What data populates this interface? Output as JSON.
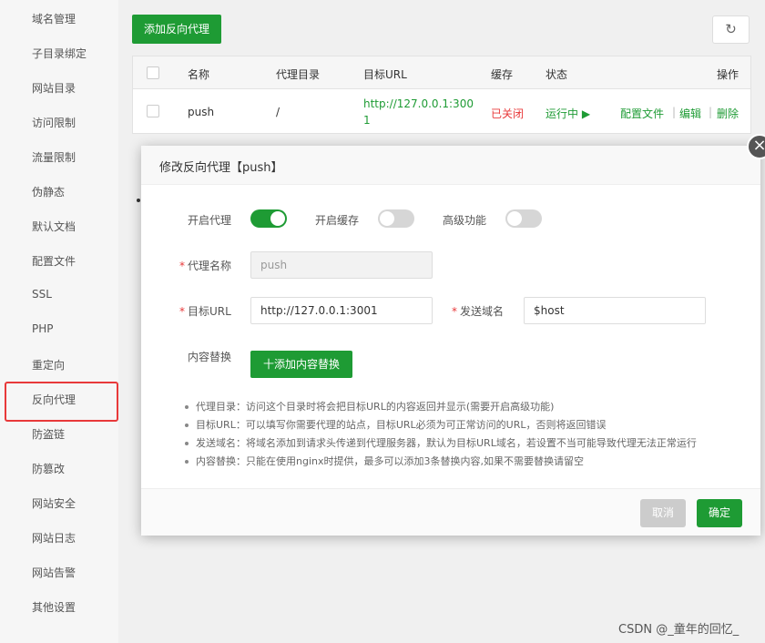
{
  "sidebar": {
    "items": [
      "域名管理",
      "子目录绑定",
      "网站目录",
      "访问限制",
      "流量限制",
      "伪静态",
      "默认文档",
      "配置文件",
      "SSL",
      "PHP",
      "重定向",
      "反向代理",
      "防盗链",
      "防篡改",
      "网站安全",
      "网站日志",
      "网站告警",
      "其他设置"
    ],
    "active": "反向代理"
  },
  "toolbar": {
    "add_proxy_label": "添加反向代理",
    "refresh_icon": "↻"
  },
  "table": {
    "headers": {
      "name": "名称",
      "dir": "代理目录",
      "url": "目标URL",
      "cache": "缓存",
      "status": "状态",
      "ops": "操作"
    },
    "row": {
      "name": "push",
      "dir": "/",
      "url_line1": "http://127.0.0.1:300",
      "url_line2": "1",
      "cache": "已关闭",
      "status": "运行中 ▶",
      "op_config": "配置文件",
      "op_edit": "编辑",
      "op_delete": "删除",
      "sep": "|"
    }
  },
  "modal": {
    "title": "修改反向代理【push】",
    "close": "×",
    "toggles": {
      "proxy_label": "开启代理",
      "proxy_on": true,
      "cache_label": "开启缓存",
      "cache_on": false,
      "advanced_label": "高级功能",
      "advanced_on": false
    },
    "required_mark": "*",
    "name_label": "代理名称",
    "name_value": "push",
    "target_label": "目标URL",
    "target_value": "http://127.0.0.1:3001",
    "host_label": "发送域名",
    "host_value": "$host",
    "replace_label": "内容替换",
    "add_replace_label": "十添加内容替换",
    "help": [
      "代理目录：访问这个目录时将会把目标URL的内容返回并显示(需要开启高级功能)",
      "目标URL：可以填写你需要代理的站点，目标URL必须为可正常访问的URL，否则将返回错误",
      "发送域名：将域名添加到请求头传递到代理服务器，默认为目标URL域名，若设置不当可能导致代理无法正常运行",
      "内容替换：只能在使用nginx时提供，最多可以添加3条替换内容,如果不需要替换请留空"
    ],
    "cancel_label": "取消",
    "ok_label": "确定"
  },
  "watermark": "CSDN @_童年的回忆_",
  "colors": {
    "accent": "#1e9b34",
    "danger": "#e8393a"
  }
}
